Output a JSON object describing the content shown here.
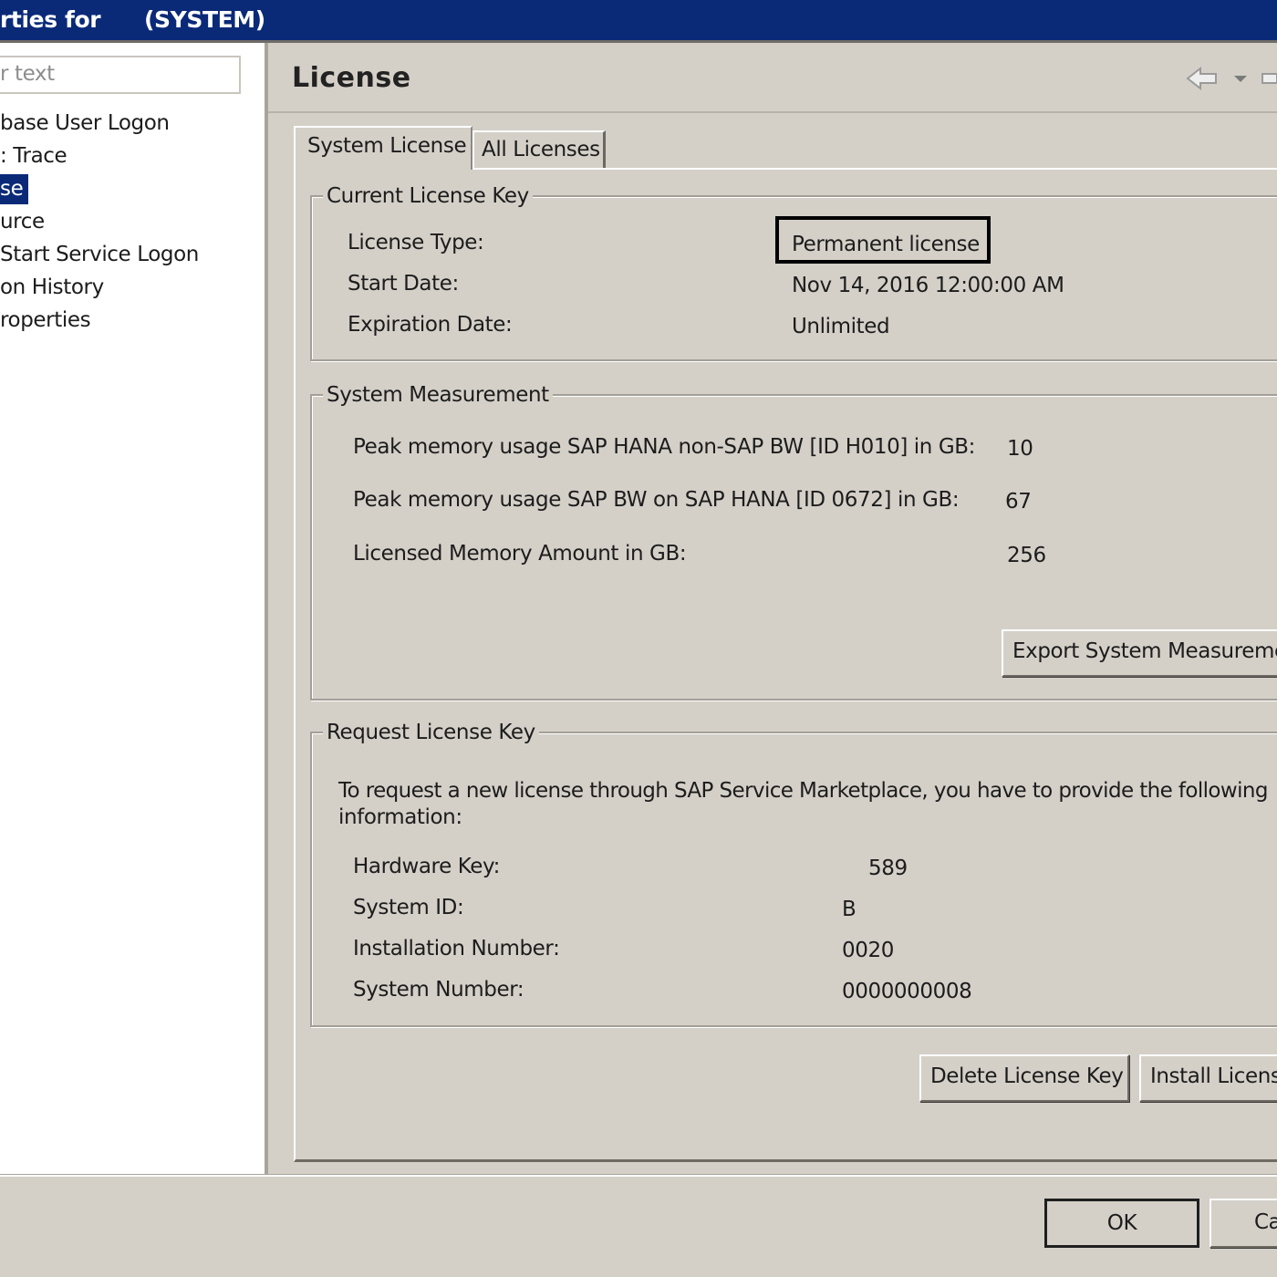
{
  "window": {
    "title": "rties for",
    "system": "(SYSTEM)"
  },
  "sidebar": {
    "filter_placeholder": "r text",
    "items": [
      {
        "label": "base User Logon"
      },
      {
        "label": ": Trace"
      },
      {
        "label": "se",
        "selected": true
      },
      {
        "label": "urce"
      },
      {
        "label": "Start Service Logon"
      },
      {
        "label": "on History"
      },
      {
        "label": "roperties"
      }
    ]
  },
  "header": {
    "title": "License"
  },
  "tabs": [
    {
      "label": "System License",
      "active": true
    },
    {
      "label": "All Licenses",
      "active": false
    }
  ],
  "current_license": {
    "group_title": "Current License Key",
    "license_type_label": "License Type:",
    "license_type_value": "Permanent license",
    "start_date_label": "Start Date:",
    "start_date_value": "Nov 14, 2016 12:00:00 AM",
    "expiration_label": "Expiration Date:",
    "expiration_value": "Unlimited"
  },
  "measurement": {
    "group_title": "System Measurement",
    "rows": [
      {
        "label": "Peak memory usage SAP HANA non-SAP BW [ID H010] in GB:",
        "value": "10"
      },
      {
        "label": "Peak memory usage SAP BW on SAP HANA [ID 0672] in GB:",
        "value": "67"
      },
      {
        "label": "Licensed Memory Amount in GB:",
        "value": "256"
      }
    ],
    "export_button": "Export System Measureme"
  },
  "request": {
    "group_title": "Request License Key",
    "description_line1": "To request a new license through SAP Service Marketplace, you have to provide the following",
    "description_line2": "information:",
    "hardware_key_label": "Hardware Key:",
    "hardware_key_value": "589",
    "system_id_label": "System ID:",
    "system_id_value": "B",
    "installation_number_label": "Installation Number:",
    "installation_number_value": "0020",
    "system_number_label": "System Number:",
    "system_number_value": "0000000008"
  },
  "actions": {
    "delete_label": "Delete License Key",
    "install_label": "Install Licens"
  },
  "dialog": {
    "ok_label": "OK",
    "cancel_label": "Ca"
  },
  "icons": {
    "back": "back-arrow-icon",
    "dropdown": "chevron-down-icon",
    "forward": "forward-arrow-icon"
  },
  "colors": {
    "titlebar": "#0a2a78",
    "panel": "#d4d0c8",
    "selection": "#0a2a78"
  }
}
